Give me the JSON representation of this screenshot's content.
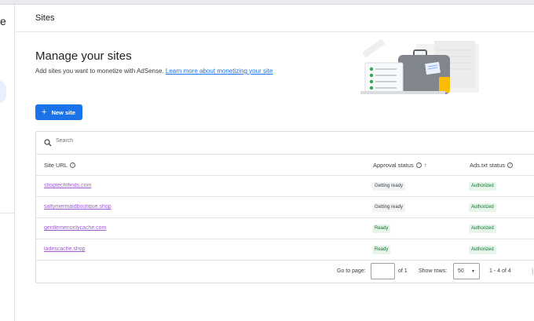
{
  "left_rail": {
    "partial_text": "e"
  },
  "header": {
    "title": "Sites"
  },
  "intro": {
    "heading": "Manage your sites",
    "description": "Add sites you want to monetize with AdSense.",
    "link_text": "Learn more about monetizing your site"
  },
  "new_site_button": {
    "label": "New site",
    "icon": "plus-icon"
  },
  "search": {
    "placeholder": "Search",
    "icon": "search-icon"
  },
  "columns": {
    "site_url": "Site URL",
    "approval_status": "Approval status",
    "ads_txt_status": "Ads.txt status"
  },
  "rows": [
    {
      "url": "shoptechtfinds.com",
      "approval": "Getting ready",
      "ads_txt": "Authorized"
    },
    {
      "url": "saltymermaidboutique.shop",
      "approval": "Getting ready",
      "ads_txt": "Authorized"
    },
    {
      "url": "gentlemenonlycache.com",
      "approval": "Ready",
      "ads_txt": "Authorized"
    },
    {
      "url": "ladescache.shop",
      "approval": "Ready",
      "ads_txt": "Authorized"
    }
  ],
  "pagination": {
    "go_to_page_label": "Go to page:",
    "page_input_value": "",
    "of_pages": "of 1",
    "show_rows_label": "Show rows:",
    "rows_per_page": "50",
    "range": "1 - 4 of 4"
  },
  "colors": {
    "primary": "#1a73e8",
    "ready_chip_bg": "#e6f4ea",
    "ready_chip_text": "#137333",
    "pending_chip_bg": "#f1f3f4"
  }
}
